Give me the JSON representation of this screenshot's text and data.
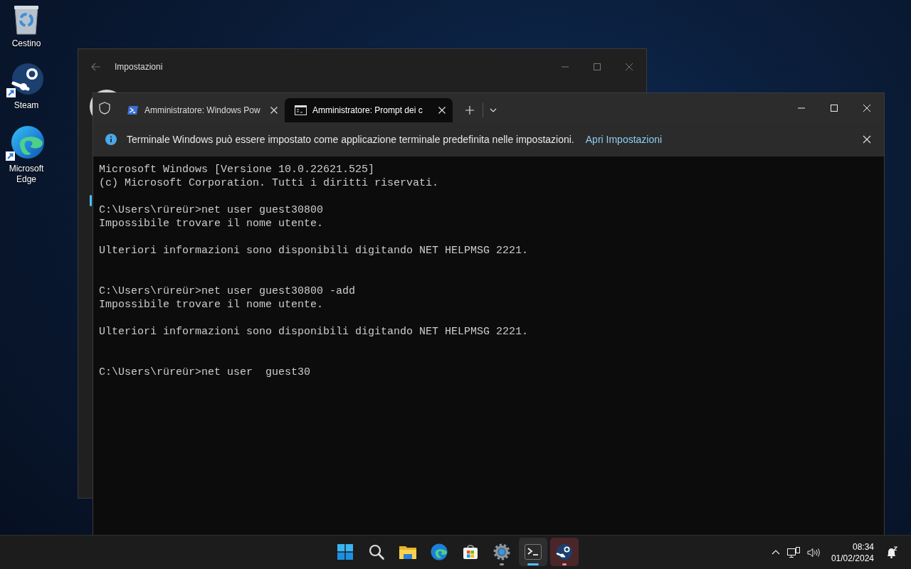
{
  "desktop_icons": [
    {
      "label": "Cestino",
      "kind": "recycle-bin",
      "shortcut": false
    },
    {
      "label": "Steam",
      "kind": "steam",
      "shortcut": true
    },
    {
      "label": "Microsoft Edge",
      "kind": "edge",
      "shortcut": true
    }
  ],
  "settings_window": {
    "title": "Impostazioni"
  },
  "terminal": {
    "tabs": [
      {
        "title": "Amministratore: Windows Pow",
        "kind": "powershell",
        "selected": false
      },
      {
        "title": "Amministratore: Prompt dei c",
        "kind": "cmd",
        "selected": true
      }
    ],
    "infobar": {
      "message": "Terminale Windows può essere impostato come applicazione terminale predefinita nelle impostazioni.",
      "link": "Apri Impostazioni"
    },
    "lines": [
      {
        "kind": "output",
        "text": "Microsoft Windows [Versione 10.0.22621.525]"
      },
      {
        "kind": "output",
        "text": "(c) Microsoft Corporation. Tutti i diritti riservati."
      },
      {
        "kind": "blank"
      },
      {
        "kind": "output",
        "text": "C:\\Users\\rüreür>net user guest30800"
      },
      {
        "kind": "output",
        "text": "Impossibile trovare il nome utente."
      },
      {
        "kind": "blank"
      },
      {
        "kind": "output",
        "text": "Ulteriori informazioni sono disponibili digitando NET HELPMSG 2221."
      },
      {
        "kind": "blank"
      },
      {
        "kind": "blank"
      },
      {
        "kind": "output",
        "text": "C:\\Users\\rüreür>net user guest30800 -add"
      },
      {
        "kind": "output",
        "text": "Impossibile trovare il nome utente."
      },
      {
        "kind": "blank"
      },
      {
        "kind": "output",
        "text": "Ulteriori informazioni sono disponibili digitando NET HELPMSG 2221."
      },
      {
        "kind": "blank"
      },
      {
        "kind": "blank"
      },
      {
        "kind": "output",
        "text": "C:\\Users\\rüreür>net user  guest30"
      }
    ]
  },
  "taskbar": {
    "apps": [
      {
        "kind": "start",
        "running": false,
        "active": false,
        "attention": false
      },
      {
        "kind": "search",
        "running": false,
        "active": false,
        "attention": false
      },
      {
        "kind": "explorer",
        "running": false,
        "active": false,
        "attention": false
      },
      {
        "kind": "edge",
        "running": false,
        "active": false,
        "attention": false
      },
      {
        "kind": "store",
        "running": false,
        "active": false,
        "attention": false
      },
      {
        "kind": "settings",
        "running": true,
        "active": false,
        "attention": false
      },
      {
        "kind": "terminal",
        "running": true,
        "active": true,
        "attention": false
      },
      {
        "kind": "steam",
        "running": true,
        "active": false,
        "attention": true
      }
    ],
    "tray": {
      "time": "08:34",
      "date": "01/02/2024"
    }
  }
}
